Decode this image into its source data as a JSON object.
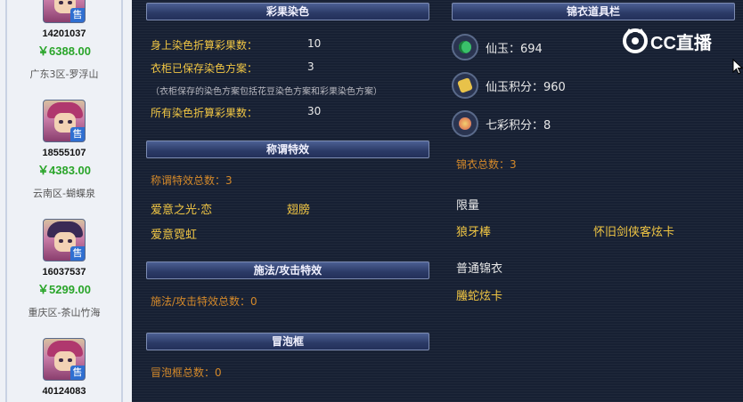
{
  "listings": [
    {
      "id": "14201037",
      "price": "￥6388.00",
      "server": "广东3区-罗浮山",
      "badge": "售"
    },
    {
      "id": "18555107",
      "price": "￥4383.00",
      "server": "云南区-蝴蝶泉",
      "badge": "售"
    },
    {
      "id": "16037537",
      "price": "￥5299.00",
      "server": "重庆区-茶山竹海",
      "badge": "售"
    },
    {
      "id": "40124083",
      "price": "",
      "server": "",
      "badge": "售"
    }
  ],
  "dye": {
    "title": "彩果染色",
    "row1_label": "身上染色折算彩果数：",
    "row1_value": "10",
    "row2_label": "衣柜已保存染色方案：",
    "row2_value": "3",
    "note": "（衣柜保存的染色方案包括花豆染色方案和彩果染色方案）",
    "row3_label": "所有染色折算彩果数：",
    "row3_value": "30"
  },
  "title_effects": {
    "title": "称谓特效",
    "total": "称谓特效总数：3",
    "items": [
      "爱意之光·恋",
      "翅膀",
      "爱意霓虹"
    ]
  },
  "spell_effects": {
    "title": "施法/攻击特效",
    "total": "施法/攻击特效总数：0"
  },
  "bubble": {
    "title": "冒泡框",
    "total": "冒泡框总数：0"
  },
  "wardrobe": {
    "title": "锦衣道具栏",
    "stats": [
      {
        "icon": "jade-coin-icon",
        "text": "仙玉：694"
      },
      {
        "icon": "jade-points-icon",
        "text": "仙玉积分：960"
      },
      {
        "icon": "rainbow-points-icon",
        "text": "七彩积分：8"
      }
    ],
    "total": "锦衣总数：3",
    "limited_label": "限量",
    "limited_items": [
      "狼牙棒",
      "怀旧剑侠客炫卡"
    ],
    "normal_label": "普通锦衣",
    "normal_items": [
      "螣蛇炫卡"
    ]
  },
  "watermark": {
    "text": "CC直播",
    "icon": "cc-logo-icon"
  },
  "colors": {
    "gold": "#f2c744",
    "orange": "#d4892a",
    "price_green": "#2aa52a",
    "panel_bg": "#172033"
  }
}
